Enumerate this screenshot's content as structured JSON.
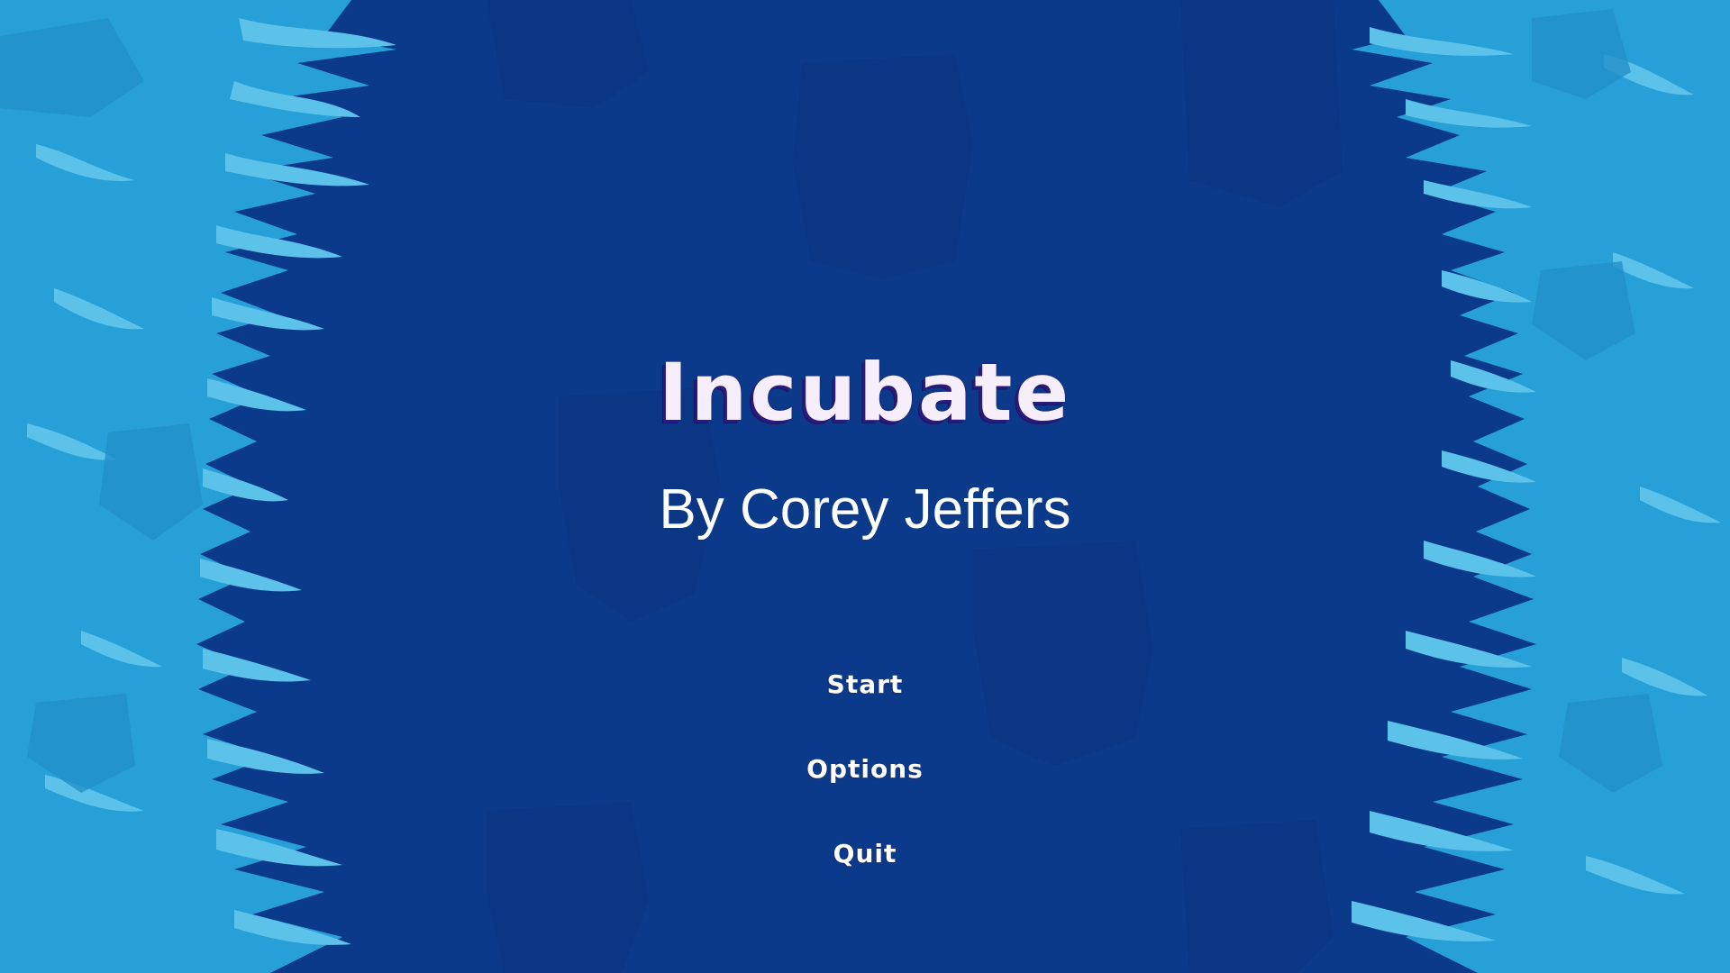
{
  "game": {
    "title": "Incubate",
    "subtitle": "By Corey Jeffers"
  },
  "menu": {
    "items": [
      {
        "label": "Start"
      },
      {
        "label": "Options"
      },
      {
        "label": "Quit"
      }
    ]
  },
  "colors": {
    "background_center": "#0c3a8a",
    "border_light": "#27a0d8",
    "border_pale": "#5cc2ea",
    "title_text": "#f6eefa",
    "title_shadow": "#2a1a7a",
    "menu_text": "#ffffff"
  }
}
